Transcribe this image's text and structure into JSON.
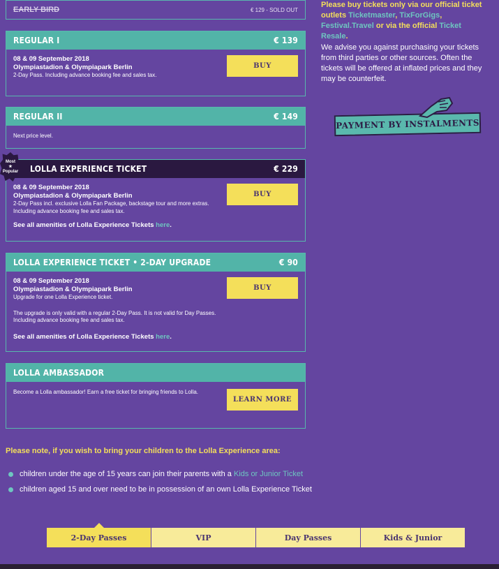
{
  "early_bird": {
    "title": "EARLY BIRD",
    "price": "€ 129 - SOLD OUT"
  },
  "cards": {
    "regular1": {
      "title": "REGULAR I",
      "price": "€ 139",
      "date": "08 & 09 September 2018",
      "venue": "Olympiastadion & Olympiapark Berlin",
      "desc": "2-Day Pass. Including advance booking fee and sales tax.",
      "button": "BUY"
    },
    "regular2": {
      "title": "REGULAR II",
      "price": "€ 149",
      "desc": "Next price level."
    },
    "experience": {
      "badge_line1": "Most",
      "badge_line2": "Popular",
      "title": "LOLLA EXPERIENCE TICKET",
      "price": "€ 229",
      "date": "08 & 09 September 2018",
      "venue": "Olympiastadion & Olympiapark Berlin",
      "desc1": "2-Day Pass incl. exclusive Lolla Fan Package, backstage tour and more extras.",
      "desc2": "Including advance booking fee and sales tax.",
      "amen": "See all amenities of Lolla Experience Tickets ",
      "link": "here",
      "dot": ".",
      "button": "BUY"
    },
    "upgrade": {
      "title": "LOLLA EXPERIENCE TICKET • 2-DAY UPGRADE",
      "price": "€ 90",
      "date": "08 & 09 September 2018",
      "venue": "Olympiastadion & Olympiapark Berlin",
      "desc": "Upgrade for one Lolla Experience ticket.",
      "note1": "The upgrade is only valid with a regular 2-Day Pass. It is not valid for Day Passes.",
      "note2": "Including advance booking fee and sales tax.",
      "amen": "See all amenities of Lolla Experience Tickets ",
      "link": "here",
      "dot": ".",
      "button": "BUY"
    },
    "ambassador": {
      "title": "LOLLA AMBASSADOR",
      "desc": "Become a Lolla ambassador! Earn a free ticket for bringing friends to Lolla.",
      "button": "LEARN MORE"
    }
  },
  "side": {
    "warn_a": "Please buy tickets only via our official ticket outlets ",
    "outlet1": "Ticketmaster",
    "sep1": ", ",
    "outlet2": "TixForGigs",
    "sep2": ", ",
    "outlet3": "Festival.Travel",
    "warn_b": " or via the official ",
    "outlet4": "Ticket Resale",
    "warn_c": ".",
    "advice": "We advise you against purchasing your tickets from third parties or other sources. Often the tickets will be offered at inflated prices and they may be counterfeit.",
    "instalments": "PAYMENT BY INSTALMENTS"
  },
  "note": {
    "heading": "Please note, if you wish to bring your children to the Lolla Experience area:",
    "b1_text": "children under the age of 15 years can join their parents with a ",
    "b1_link": "Kids or Junior Ticket",
    "b2_text": "children aged 15 and over need to be in possession of an own Lolla Experience Ticket"
  },
  "tabs": [
    "2-Day Passes",
    "VIP",
    "Day Passes",
    "Kids & Junior"
  ]
}
